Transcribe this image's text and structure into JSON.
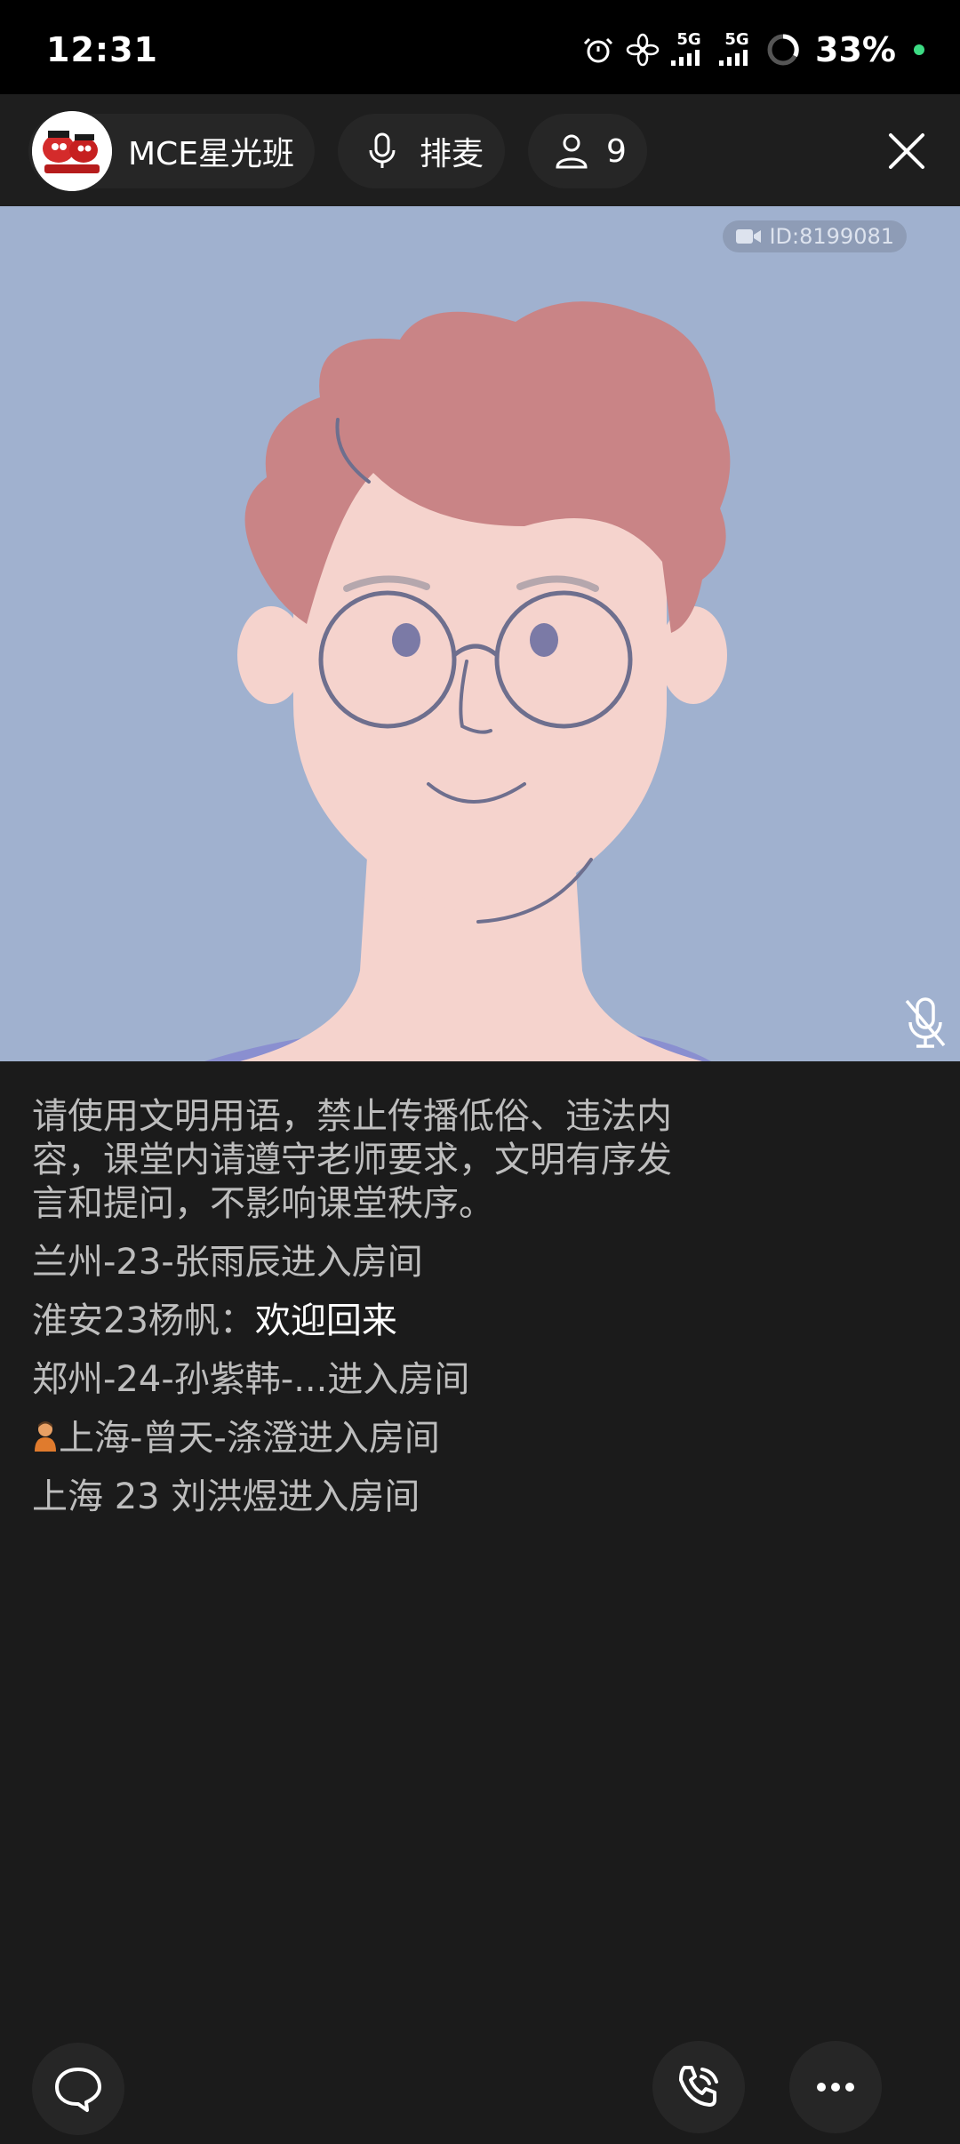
{
  "status_bar": {
    "time": "12:31",
    "net1": "5G",
    "net2": "5G",
    "battery": "33%",
    "icons": [
      "alarm-icon",
      "fan-icon",
      "signal-5g-icon",
      "signal-5g-icon",
      "battery-ring-icon"
    ]
  },
  "header": {
    "room_name": "MCE星光班",
    "mic_queue_label": "排麦",
    "user_count": "9"
  },
  "video": {
    "id_label": "ID:8199081"
  },
  "chat": {
    "notice": "请使用文明用语，禁止传播低俗、违法内容，课堂内请遵守老师要求，文明有序发言和提问，不影响课堂秩序。",
    "messages": [
      {
        "prefix": "兰州-23-张雨辰进入房间",
        "text": ""
      },
      {
        "prefix": "淮安23杨帆：",
        "text": "欢迎回来"
      },
      {
        "prefix": "郑州-24-孙紫韩-...进入房间",
        "text": ""
      },
      {
        "prefix": "上海-曾天-涤澄进入房间",
        "text": ""
      },
      {
        "prefix": "上海 23 刘洪煜进入房间",
        "text": ""
      }
    ]
  },
  "colors": {
    "background": "#1b1b1b",
    "video_background": "#a0b1cf",
    "hair": "#c98486",
    "skin": "#f5d3cd"
  }
}
